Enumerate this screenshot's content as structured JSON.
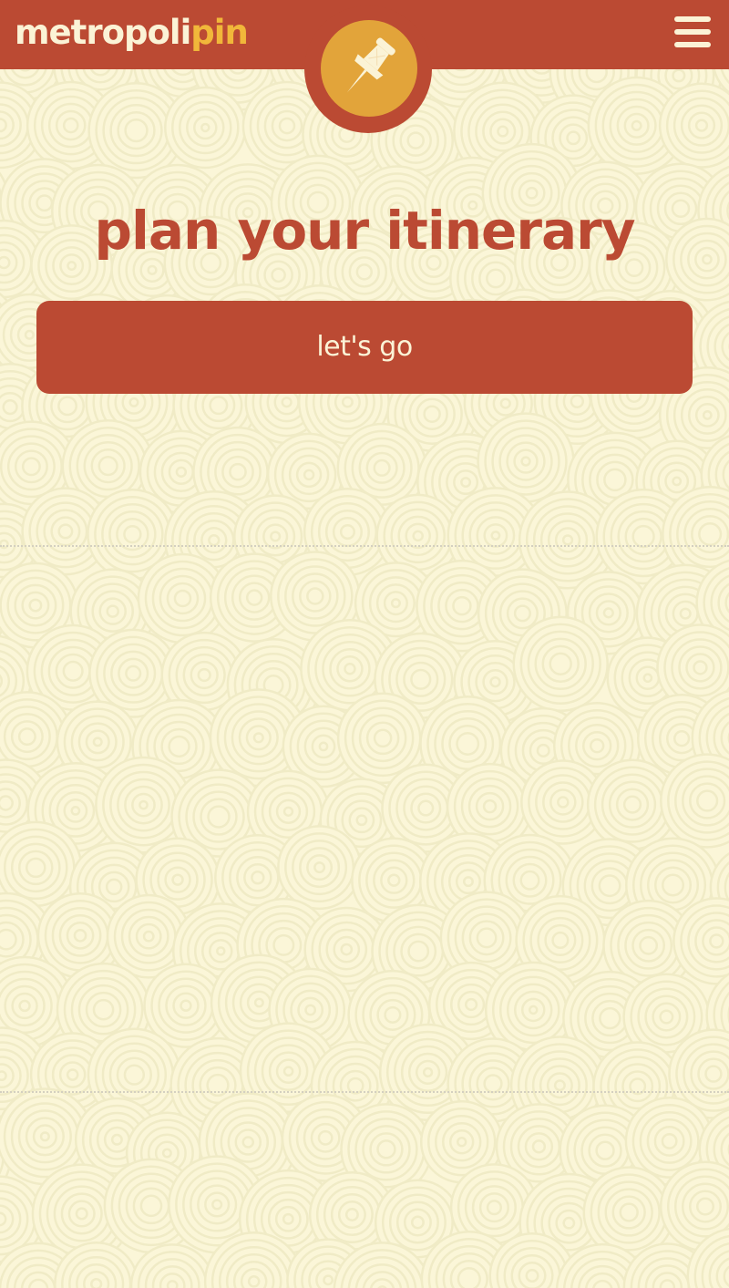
{
  "header": {
    "brand_part_a": "metropoli",
    "brand_part_b": "pin",
    "menu_icon": "hamburger-menu-icon",
    "badge_icon": "pushpin-icon"
  },
  "main": {
    "title": "plan your itinerary",
    "cta_label": "let's go"
  },
  "colors": {
    "primary": "#bb4a33",
    "accent": "#f1b73a",
    "badge_fill": "#e2a43a",
    "background": "#fbf6d8",
    "pattern_ring": "#f0ebc6",
    "text_light": "#fbf3d6"
  }
}
